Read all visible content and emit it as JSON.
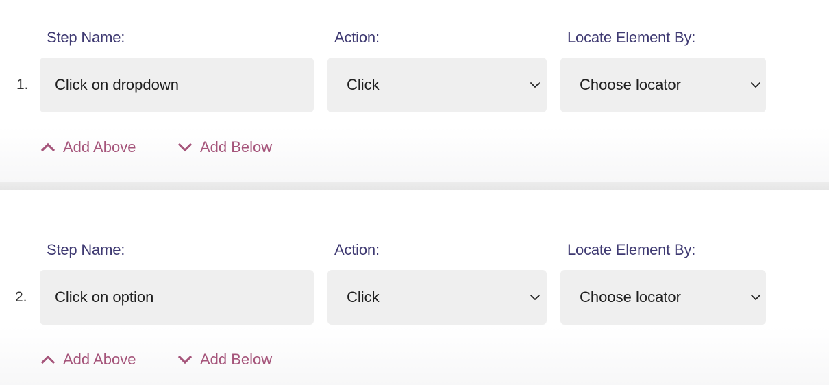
{
  "labels": {
    "step_name": "Step Name:",
    "action": "Action:",
    "locate_by": "Locate Element By:"
  },
  "links": {
    "add_above": "Add Above",
    "add_below": "Add Below"
  },
  "icons": {
    "select_arrow": "chevron-down-icon",
    "add_above": "chevron-up-icon",
    "add_below": "chevron-down-icon"
  },
  "colors": {
    "label": "#3f3a72",
    "link": "#a5547a",
    "field_bg": "#efefef",
    "text": "#1f1f1f"
  },
  "steps": [
    {
      "number": "1.",
      "step_name": "Click on dropdown",
      "action": "Click",
      "locator": "Choose locator"
    },
    {
      "number": "2.",
      "step_name": "Click on option",
      "action": "Click",
      "locator": "Choose locator"
    }
  ]
}
